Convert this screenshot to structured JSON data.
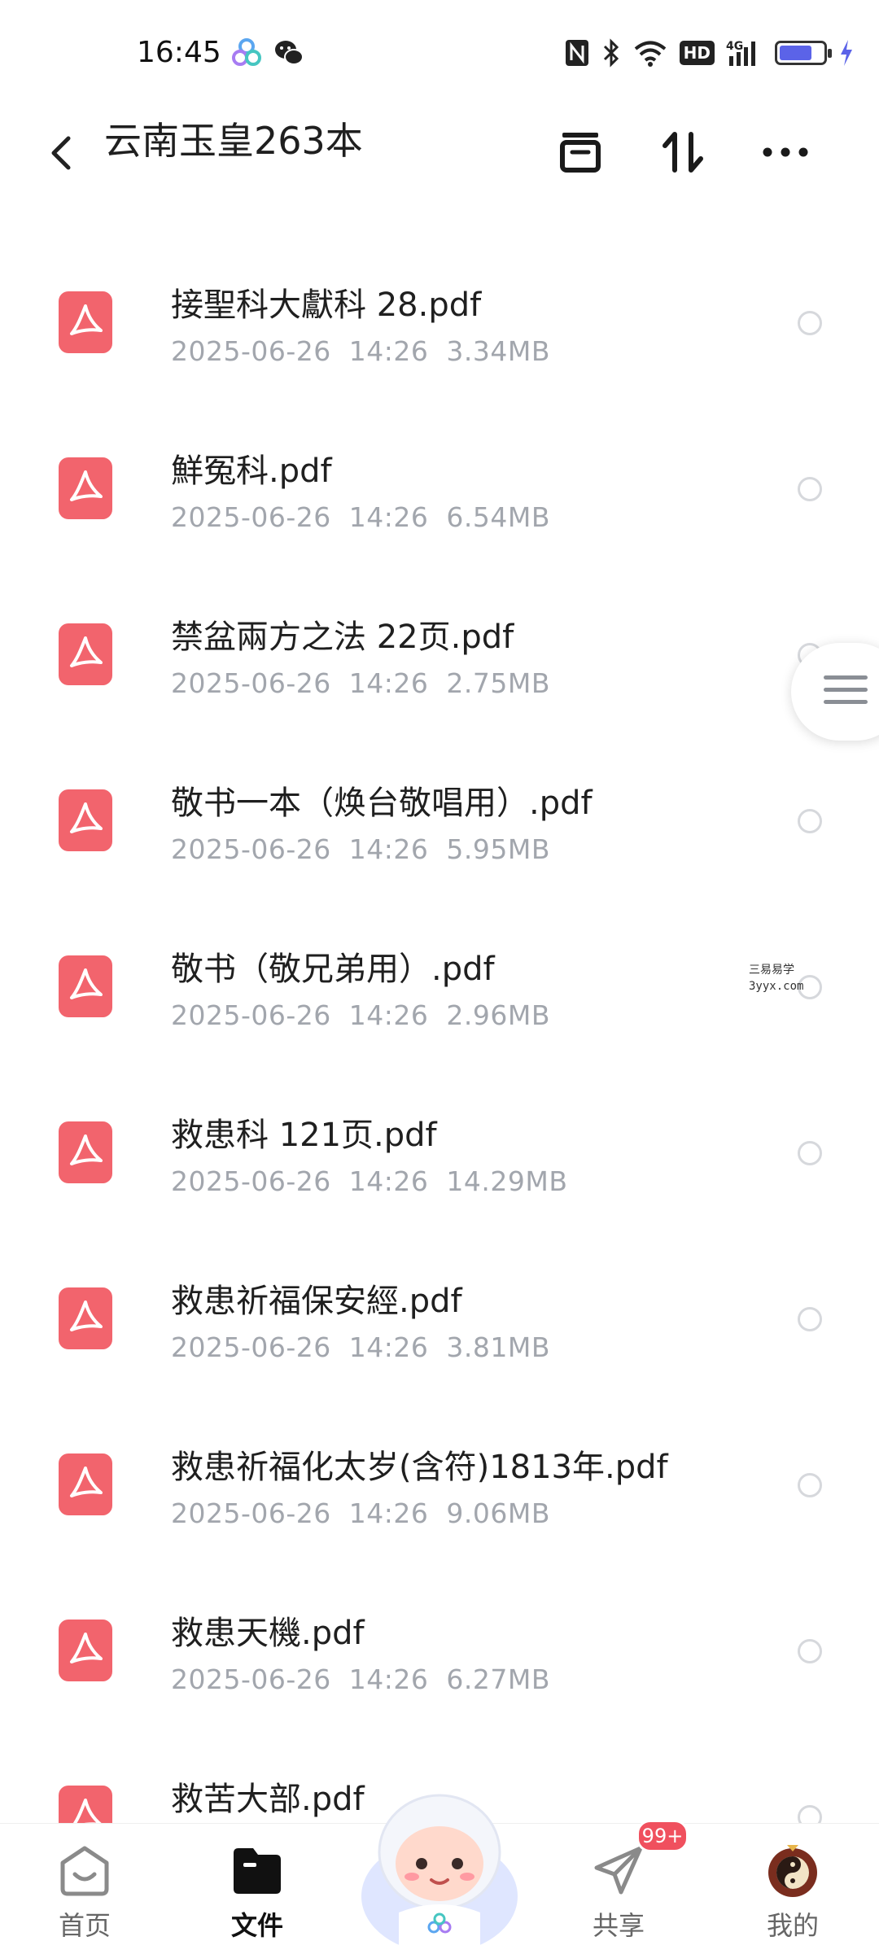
{
  "status_bar": {
    "time": "16:45",
    "icons": [
      "app-cloud-icon",
      "wechat-icon",
      "nfc-icon",
      "bluetooth-icon",
      "wifi-icon",
      "hd-icon",
      "signal-4g-icon",
      "battery-icon",
      "charging-icon"
    ],
    "hd_label": "HD",
    "battery_level": 0.75
  },
  "header": {
    "title": "云南玉皇263本",
    "actions": [
      "archive-icon",
      "sort-icon",
      "more-icon"
    ]
  },
  "files": [
    {
      "name": "接聖科大獻科 28.pdf",
      "date": "2025-06-26",
      "time": "14:26",
      "size": "3.34MB"
    },
    {
      "name": "鮮冤科.pdf",
      "date": "2025-06-26",
      "time": "14:26",
      "size": "6.54MB"
    },
    {
      "name": "禁盆兩方之法 22页.pdf",
      "date": "2025-06-26",
      "time": "14:26",
      "size": "2.75MB"
    },
    {
      "name": "敬书一本（焕台敬唱用）.pdf",
      "date": "2025-06-26",
      "time": "14:26",
      "size": "5.95MB"
    },
    {
      "name": "敬书（敬兄弟用）.pdf",
      "date": "2025-06-26",
      "time": "14:26",
      "size": "2.96MB"
    },
    {
      "name": "救患科 121页.pdf",
      "date": "2025-06-26",
      "time": "14:26",
      "size": "14.29MB"
    },
    {
      "name": "救患祈福保安經.pdf",
      "date": "2025-06-26",
      "time": "14:26",
      "size": "3.81MB"
    },
    {
      "name": "救患祈福化太岁(含符)1813年.pdf",
      "date": "2025-06-26",
      "time": "14:26",
      "size": "9.06MB"
    },
    {
      "name": "救患天機.pdf",
      "date": "2025-06-26",
      "time": "14:26",
      "size": "6.27MB"
    },
    {
      "name": "救苦大部.pdf",
      "date": "",
      "time": "",
      "size": ""
    }
  ],
  "watermark": {
    "line1": "三易易学",
    "line2": "3yyx.com"
  },
  "bottom_nav": {
    "home": "首页",
    "files": "文件",
    "share": "共享",
    "share_badge": "99+",
    "mine": "我的"
  },
  "colors": {
    "pdf": "#f2646d",
    "meta": "#a2a6ad",
    "accent": "#5b63e8",
    "badge": "#f0505e"
  }
}
